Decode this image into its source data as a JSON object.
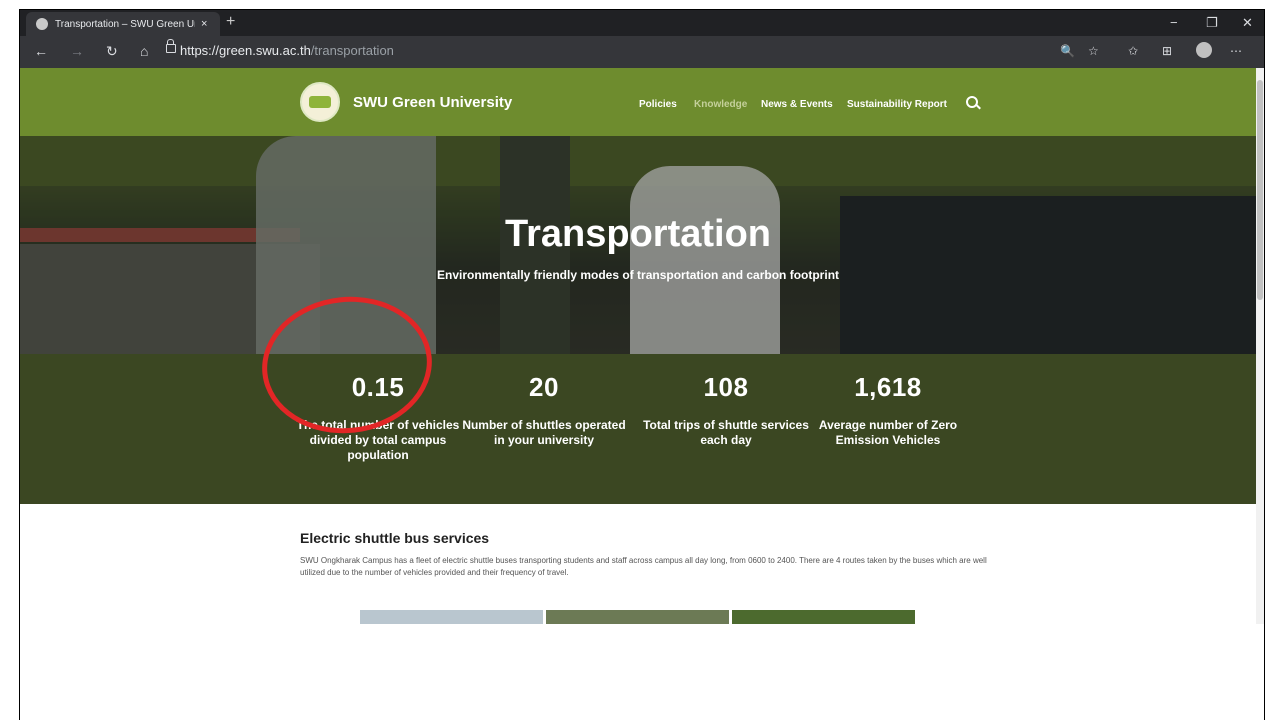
{
  "browser": {
    "tab_title": "Transportation – SWU Green Uni",
    "tab_close": "×",
    "new_tab": "+",
    "url_host": "https://green.swu.ac.th",
    "url_path": "/transportation",
    "controls": {
      "minimize": "−",
      "maximize": "❐",
      "close": "✕"
    },
    "nav": {
      "back": "←",
      "forward": "→",
      "refresh": "↻",
      "home": "⌂"
    },
    "icons": {
      "zoom": "🔍",
      "favorite": "☆",
      "favorites": "✩",
      "collections": "⊞",
      "more": "⋯"
    }
  },
  "header": {
    "brand": "SWU Green University",
    "menu": [
      "Policies",
      "Knowledge",
      "News & Events",
      "Sustainability Report"
    ]
  },
  "hero": {
    "title": "Transportation",
    "subtitle": "Environmentally friendly modes of transportation and carbon footprint"
  },
  "stats": [
    {
      "value": "0.15",
      "label": "The total number of vehicles divided by total campus population"
    },
    {
      "value": "20",
      "label": "Number of shuttles operated in your university"
    },
    {
      "value": "108",
      "label": "Total trips of shuttle services each day"
    },
    {
      "value": "1,618",
      "label": "Average number of Zero Emission Vehicles"
    }
  ],
  "content": {
    "title": "Electric shuttle bus services",
    "paragraph": "SWU Ongkharak Campus has a fleet of electric shuttle buses transporting students and staff across campus all day long, from 0600 to 2400. There are 4 routes taken by the buses which are well utilized due to the number of vehicles provided and their frequency of travel."
  },
  "colors": {
    "header_green": "#6e8c2e",
    "stats_green": "#3b4722",
    "highlight_red": "#e22626"
  }
}
